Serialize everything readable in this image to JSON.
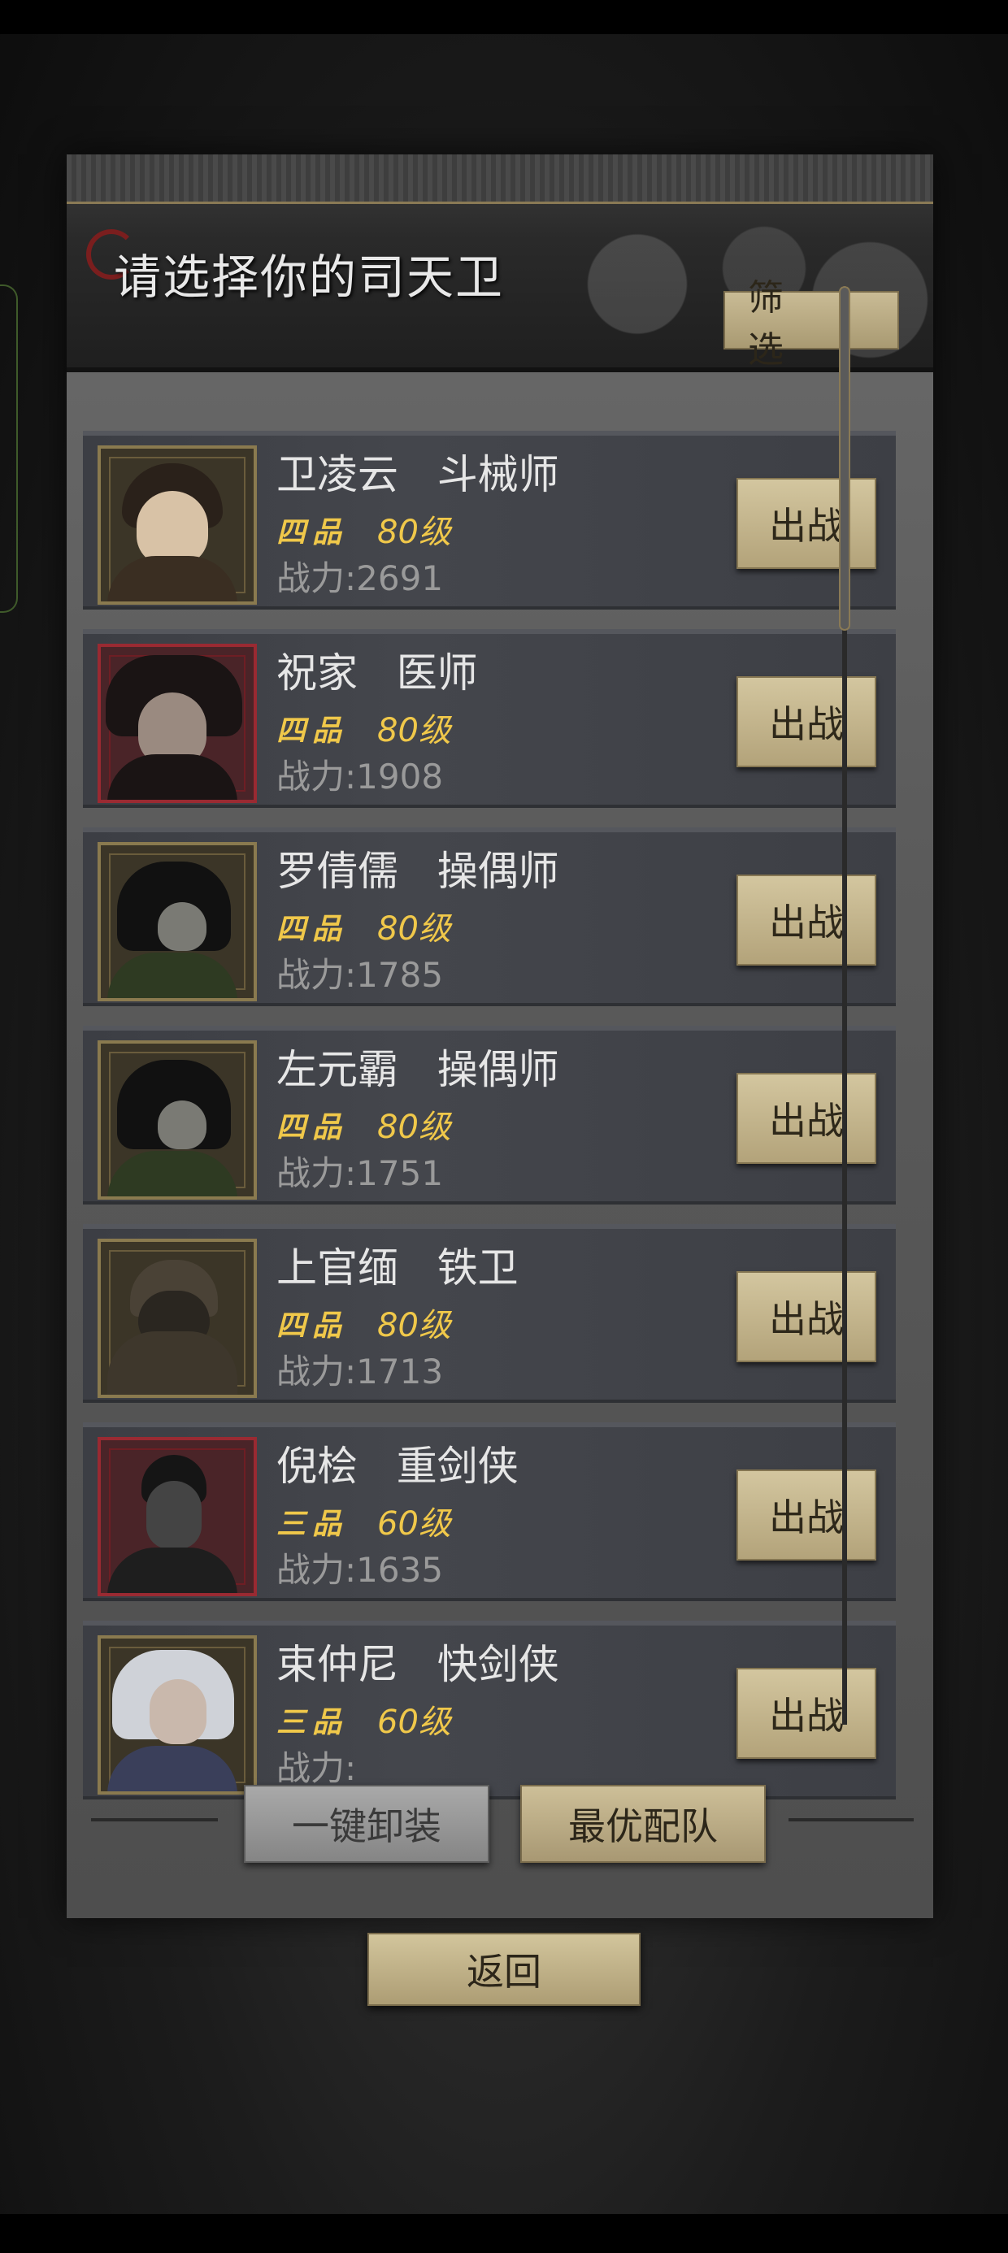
{
  "panel": {
    "title": "请选择你的司天卫",
    "filter_label": "筛 选"
  },
  "guards": [
    {
      "name": "卫凌云",
      "class": "斗械师",
      "grade": "四品",
      "level": "80级",
      "power_label": "战力:",
      "power": "2691",
      "portrait_frame": "gold",
      "fight_label": "出战"
    },
    {
      "name": "祝家",
      "class": "医师",
      "grade": "四品",
      "level": "80级",
      "power_label": "战力:",
      "power": "1908",
      "portrait_frame": "red",
      "fight_label": "出战"
    },
    {
      "name": "罗倩儒",
      "class": "操偶师",
      "grade": "四品",
      "level": "80级",
      "power_label": "战力:",
      "power": "1785",
      "portrait_frame": "gold",
      "fight_label": "出战"
    },
    {
      "name": "左元霸",
      "class": "操偶师",
      "grade": "四品",
      "level": "80级",
      "power_label": "战力:",
      "power": "1751",
      "portrait_frame": "gold",
      "fight_label": "出战"
    },
    {
      "name": "上官缅",
      "class": "铁卫",
      "grade": "四品",
      "level": "80级",
      "power_label": "战力:",
      "power": "1713",
      "portrait_frame": "gold",
      "fight_label": "出战"
    },
    {
      "name": "倪桧",
      "class": "重剑侠",
      "grade": "三品",
      "level": "60级",
      "power_label": "战力:",
      "power": "1635",
      "portrait_frame": "red",
      "fight_label": "出战"
    },
    {
      "name": "束仲尼",
      "class": "快剑侠",
      "grade": "三品",
      "level": "60级",
      "power_label": "战力:",
      "power": "",
      "portrait_frame": "gold",
      "fight_label": "出战"
    }
  ],
  "footer": {
    "unequip_label": "一键卸装",
    "best_team_label": "最优配队",
    "back_label": "返回"
  },
  "colors": {
    "gold_accent": "#f0c84a",
    "button_tan": "#c9bb95",
    "frame_red": "#9a2a32",
    "frame_gold": "#8a7a4f"
  }
}
